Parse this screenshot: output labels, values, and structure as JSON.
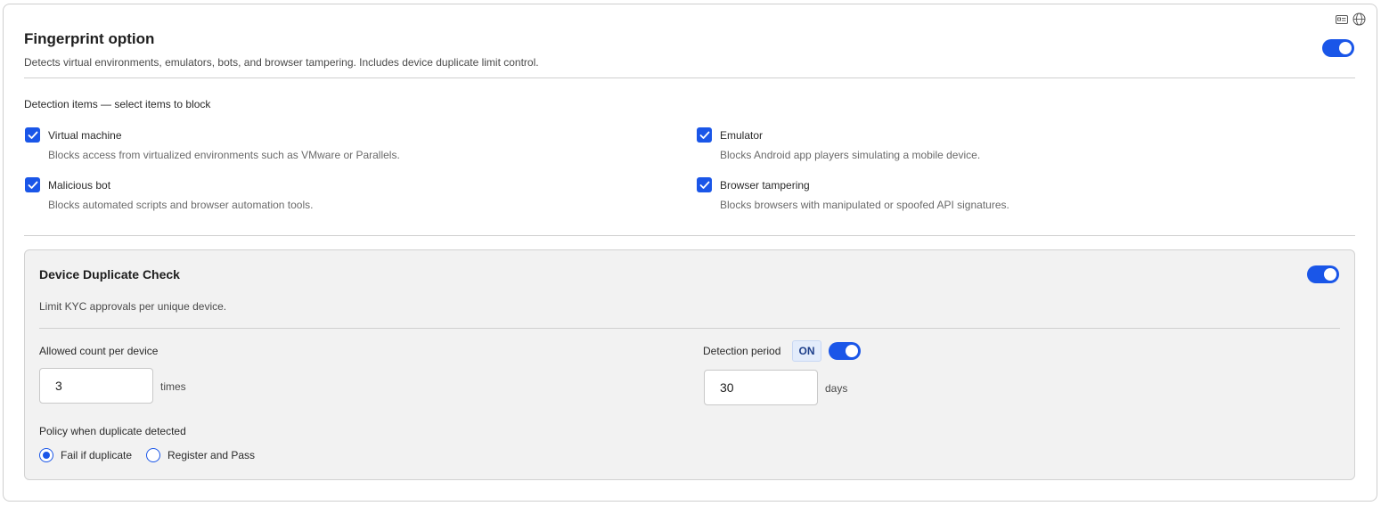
{
  "header": {
    "title": "Fingerprint option",
    "subtitle": "Detects virtual environments, emulators, bots, and browser tampering. Includes device duplicate limit control.",
    "enabled": true
  },
  "corner_icons": [
    "id-card-icon",
    "globe-icon"
  ],
  "detection": {
    "label": "Detection items — select items to block",
    "items": [
      {
        "label": "Virtual machine",
        "desc": "Blocks access from virtualized environments such as VMware or Parallels.",
        "checked": true
      },
      {
        "label": "Emulator",
        "desc": "Blocks Android app players simulating a mobile device.",
        "checked": true
      },
      {
        "label": "Malicious bot",
        "desc": "Blocks automated scripts and browser automation tools.",
        "checked": true
      },
      {
        "label": "Browser tampering",
        "desc": "Blocks browsers with manipulated or spoofed API signatures.",
        "checked": true
      }
    ]
  },
  "duplicate": {
    "title": "Device Duplicate Check",
    "desc": "Limit KYC approvals per unique device.",
    "enabled": true,
    "allowed_label": "Allowed count per device",
    "allowed_value": "3",
    "allowed_unit": "times",
    "period_label": "Detection period",
    "period_badge": "ON",
    "period_enabled": true,
    "period_value": "30",
    "period_unit": "days",
    "policy_label": "Policy when duplicate detected",
    "policy_options": [
      {
        "label": "Fail if duplicate",
        "selected": true
      },
      {
        "label": "Register and Pass",
        "selected": false
      }
    ]
  },
  "colors": {
    "accent": "#1a56e8",
    "panel_bg": "#f2f2f2",
    "border": "#cfcfcf"
  }
}
